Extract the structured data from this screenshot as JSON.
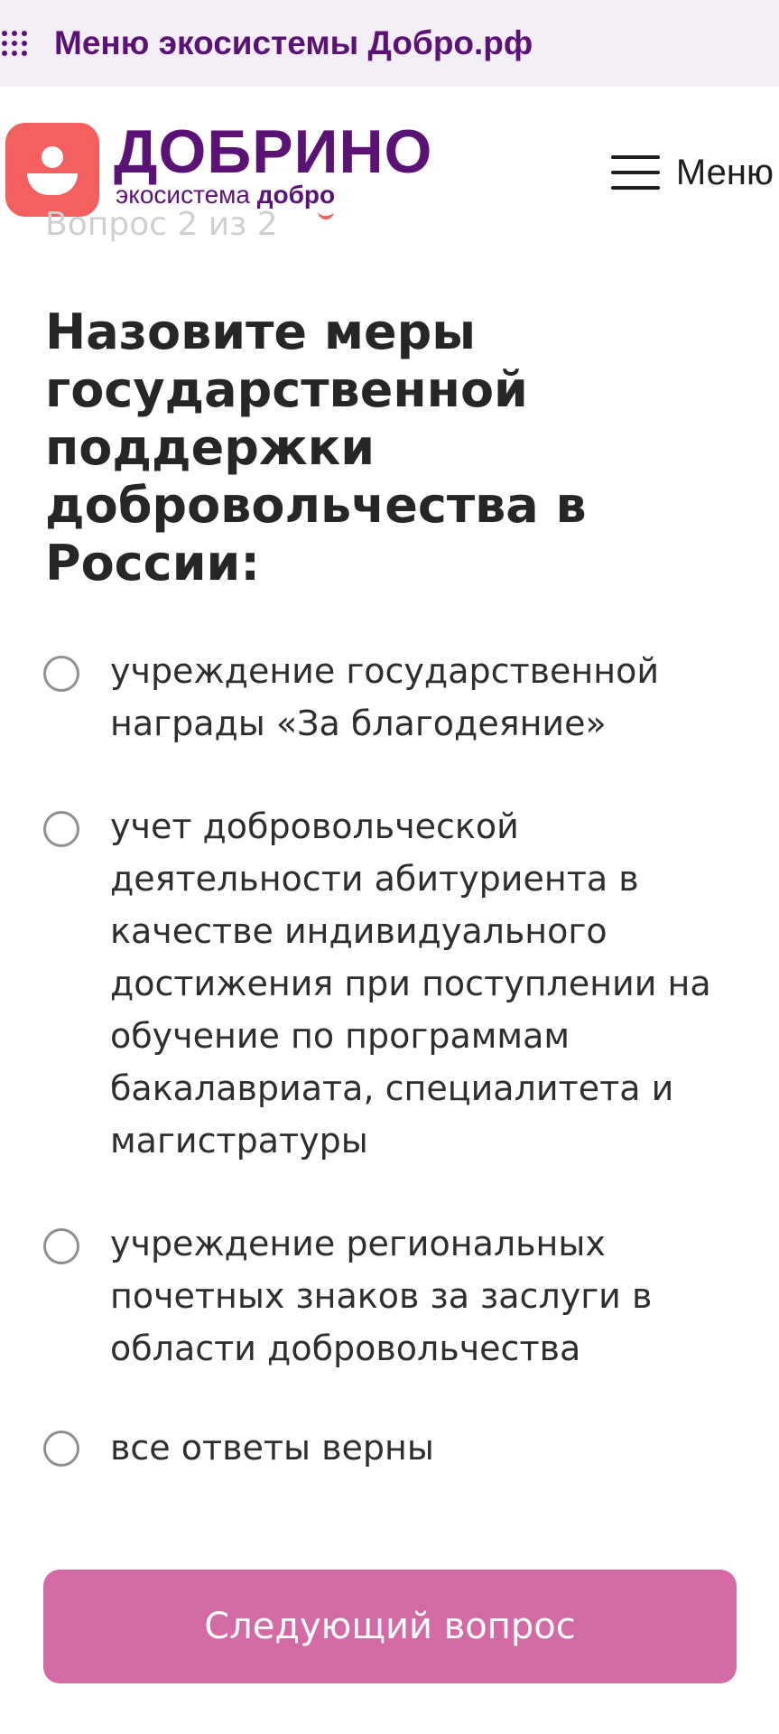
{
  "ecosystem_bar": {
    "icon": "grid-dots-icon",
    "label": "Меню экосистемы Добро.рф"
  },
  "header": {
    "logo_icon": "person-smile-icon",
    "brand_name": "ДОБРИНО",
    "brand_sub_prefix": "экосистема",
    "brand_sub_bold": "добро",
    "menu_icon": "hamburger-icon",
    "menu_label": "Меню"
  },
  "quiz": {
    "progress": "Вопрос 2 из 2",
    "question": "Назовите меры государственной поддержки добровольчества в России:",
    "options": [
      {
        "label": "учреждение государственной награды «За благодеяние»",
        "selected": false
      },
      {
        "label": "учет добровольческой деятельности абитуриента в качестве индивидуального достижения при поступлении на обучение по программам бакалавриата, специалитета и магистратуры",
        "selected": false
      },
      {
        "label": "учреждение региональных почетных знаков за заслуги в области добровольчества",
        "selected": false
      },
      {
        "label": "все ответы верны",
        "selected": false
      }
    ],
    "next_button": "Следующий вопрос"
  },
  "colors": {
    "brand_purple": "#5a1374",
    "logo_coral": "#f3605f",
    "button_pink": "#d46aa5",
    "eco_bar_bg": "#f3eef6"
  }
}
